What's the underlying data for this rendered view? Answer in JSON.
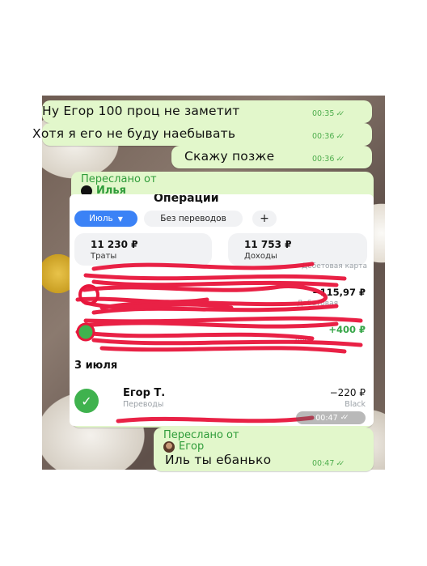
{
  "messages": [
    {
      "text": "Ну Егор 100 проц не заметит",
      "time": "00:35"
    },
    {
      "text": "Хотя я его не буду наебывать",
      "time": "00:36"
    },
    {
      "text": "Скажу позже",
      "time": "00:36"
    }
  ],
  "forward1": {
    "label": "Переслано от",
    "sender": "Илья",
    "time": "00:47",
    "screenshot": {
      "title": "Операции",
      "filter_month": "Июль",
      "filter_transfers": "Без переводов",
      "filter_add": "+",
      "spent_amount": "11 230 ₽",
      "spent_label": "Траты",
      "income_amount": "11 753 ₽",
      "income_label": "Доходы",
      "row1_sub": "Дебетовая карта",
      "row2_amount": "−115,97 ₽",
      "row2_sub": "Дебетовая",
      "row3_amount": "+400 ₽",
      "row3_sub": "Деб",
      "date_header": "3 июля",
      "op_name": "Егор Т.",
      "op_category": "Переводы",
      "op_amount": "−220 ₽",
      "op_card": "Black"
    }
  },
  "forward2": {
    "label": "Переслано от",
    "sender": "Егор",
    "text": "Иль ты ебанько",
    "time": "00:47"
  },
  "colors": {
    "bubble": "#e2f7cb",
    "accent_green": "#2f9c3a",
    "scribble_red": "#e8163c"
  }
}
